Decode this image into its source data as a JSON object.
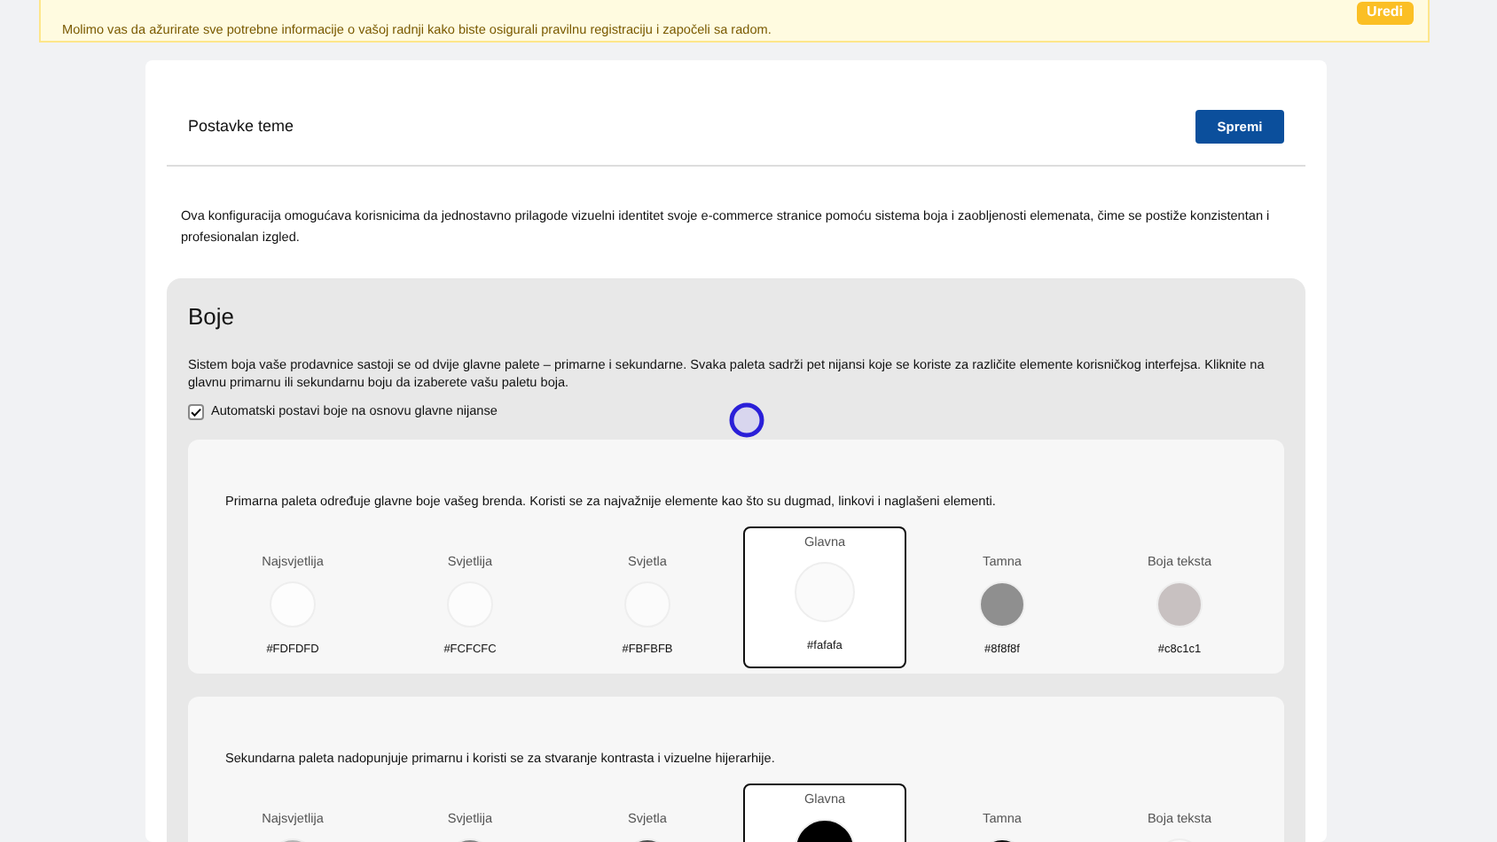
{
  "banner": {
    "message": "Molimo vas da ažurirate sve potrebne informacije o vašoj radnji kako biste osigurali pravilnu registraciju i započeli sa radom.",
    "button": "Uredi"
  },
  "header": {
    "title": "Postavke teme",
    "save_button": "Spremi"
  },
  "description": "Ova konfiguracija omogućava korisnicima da jednostavno prilagode vizuelni identitet svoje e-commerce stranice pomoću sistema boja i zaobljenosti elemenata, čime se postiže konzistentan i profesionalan izgled.",
  "colors_section": {
    "title": "Boje",
    "description": "Sistem boja vaše prodavnice sastoji se od dvije glavne palete – primarne i sekundarne. Svaka paleta sadrži pet nijansi koje se koriste za različite elemente korisničkog interfejsa. Kliknite na glavnu primarnu ili sekundarnu boju da izaberete vašu paletu boja.",
    "auto_checkbox": {
      "label": "Automatski postavi boje na osnovu glavne nijanse",
      "checked": true
    }
  },
  "palettes": [
    {
      "description": "Primarna paleta određuje glavne boje vašeg brenda. Koristi se za najvažnije elemente kao što su dugmad, linkovi i naglašeni elementi.",
      "swatches": [
        {
          "label": "Najsvjetlija",
          "color": "#fdfdfd",
          "hex": "#FDFDFD",
          "selected": false
        },
        {
          "label": "Svjetlija",
          "color": "#fcfcfc",
          "hex": "#FCFCFC",
          "selected": false
        },
        {
          "label": "Svjetla",
          "color": "#fbfbfb",
          "hex": "#FBFBFB",
          "selected": false
        },
        {
          "label": "Glavna",
          "color": "#fafafa",
          "hex": "#fafafa",
          "selected": true
        },
        {
          "label": "Tamna",
          "color": "#8f8f8f",
          "hex": "#8f8f8f",
          "selected": false
        },
        {
          "label": "Boja teksta",
          "color": "#c8c1c1",
          "hex": "#c8c1c1",
          "selected": false
        }
      ]
    },
    {
      "description": "Sekundarna paleta nadopunjuje primarnu i koristi se za stvaranje kontrasta i vizuelne hijerarhije.",
      "swatches": [
        {
          "label": "Najsvjetlija",
          "color": "#b3b3b3",
          "selected": false
        },
        {
          "label": "Svjetlija",
          "color": "#808080",
          "selected": false
        },
        {
          "label": "Svjetla",
          "color": "#4d4d4d",
          "selected": false
        },
        {
          "label": "Glavna",
          "color": "#000000",
          "selected": true
        },
        {
          "label": "Tamna",
          "color": "#0d0d0d",
          "selected": false
        },
        {
          "label": "Boja teksta",
          "color": "#fafafa",
          "selected": false
        }
      ]
    }
  ]
}
